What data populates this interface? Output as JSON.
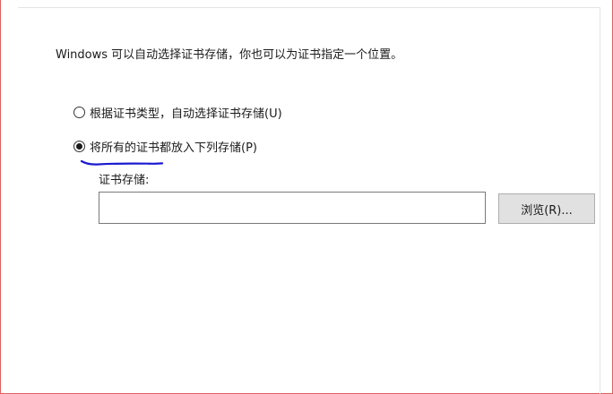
{
  "dialog": {
    "description": "Windows 可以自动选择证书存储，你也可以为证书指定一个位置。",
    "options": [
      {
        "label": "根据证书类型，自动选择证书存储(U)",
        "selected": false
      },
      {
        "label": "将所有的证书都放入下列存储(P)",
        "selected": true
      }
    ],
    "store": {
      "label": "证书存储:",
      "value": "",
      "browse_label": "浏览(R)..."
    }
  },
  "colors": {
    "annotation_underline": "#1a1ad0",
    "screenshot_border": "#e06060",
    "button_face": "#e1e1e1"
  }
}
